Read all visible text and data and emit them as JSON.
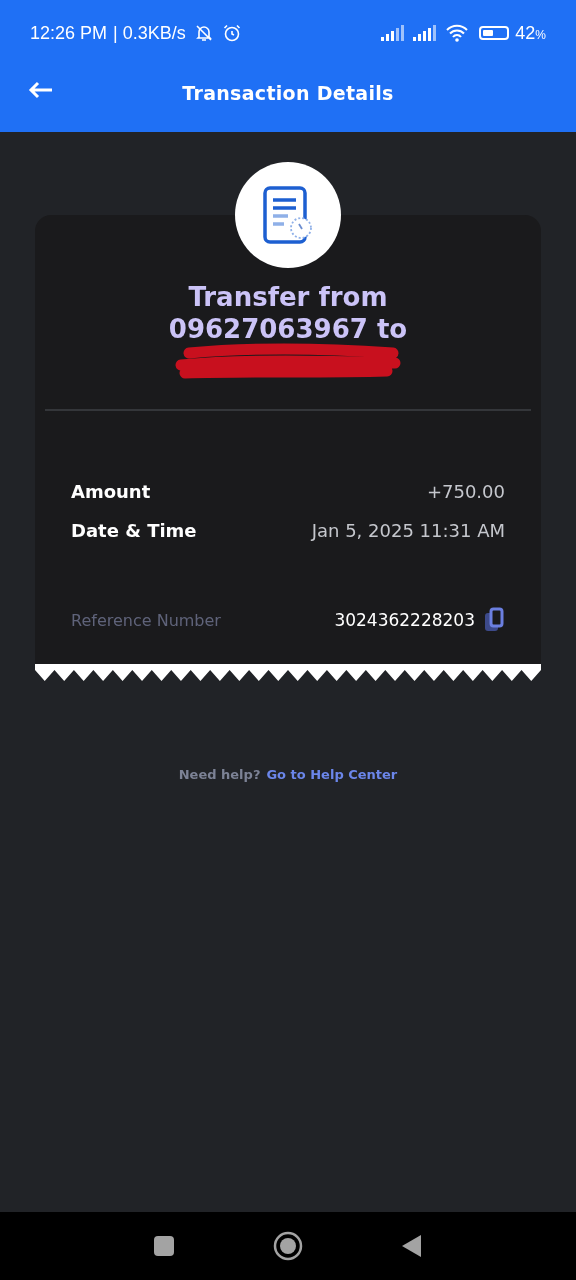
{
  "status_bar": {
    "time": "12:26 PM",
    "speed": "| 0.3KB/s",
    "battery": "42",
    "battery_unit": "%"
  },
  "header": {
    "title": "Transaction Details"
  },
  "receipt": {
    "title": "Transfer from 09627063967 to",
    "details": [
      {
        "label": "Amount",
        "value": "+750.00"
      },
      {
        "label": "Date & Time",
        "value": "Jan 5, 2025 11:31 AM"
      }
    ],
    "reference": {
      "label": "Reference Number",
      "value": "3024362228203"
    }
  },
  "help": {
    "text": "Need help?",
    "link": "Go to Help Center"
  }
}
